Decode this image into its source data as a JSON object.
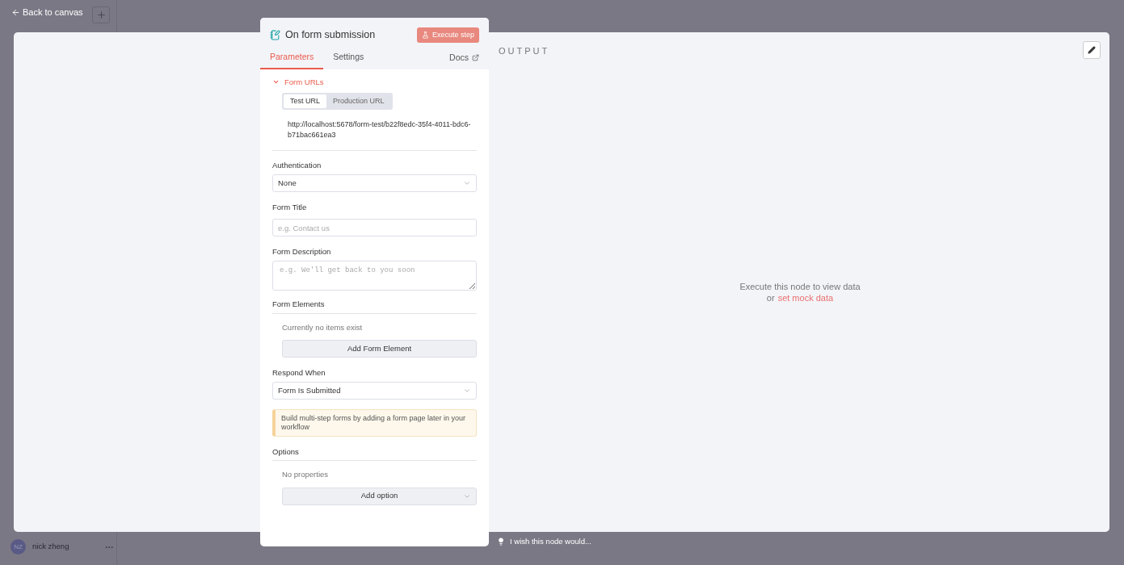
{
  "top_bar": {
    "back_link": "Back to canvas"
  },
  "user": {
    "initials": "NZ",
    "name": "nick zheng"
  },
  "feedback": {
    "text": "I wish this node would..."
  },
  "node_panel": {
    "title": "On form submission",
    "execute_button": {
      "label": "Execute step",
      "disabled": true
    },
    "tabs": [
      {
        "label": "Parameters",
        "selected": true
      },
      {
        "label": "Settings",
        "selected": false
      }
    ],
    "docs_link": "Docs",
    "form_urls": {
      "title": "Form URLs",
      "expanded": true,
      "url_tabs": [
        {
          "label": "Test URL",
          "selected": true
        },
        {
          "label": "Production URL",
          "selected": false
        }
      ],
      "url": "http://localhost:5678/form-test/b22f8edc-35f4-4011-bdc6-b71bac661ea3"
    },
    "parameters": [
      {
        "kind": "select",
        "label": "Authentication",
        "value": "None"
      },
      {
        "kind": "input",
        "label": "Form Title",
        "placeholder": "e.g. Contact us"
      },
      {
        "kind": "textarea",
        "label": "Form Description",
        "placeholder": "e.g. We'll get back to you soon"
      },
      {
        "kind": "collection",
        "label": "Form Elements",
        "empty_text": "Currently no items exist",
        "button": "Add Form Element"
      },
      {
        "kind": "select",
        "label": "Respond When",
        "value": "Form Is Submitted"
      },
      {
        "kind": "notice",
        "text": "Build multi-step forms by adding a form page later in your workflow"
      },
      {
        "kind": "options",
        "label": "Options",
        "empty_text": "No properties",
        "button": "Add option"
      }
    ]
  },
  "output": {
    "title": "OUTPUT",
    "empty_message": "Execute this node to view data",
    "mock_prefix": "or",
    "mock_link": "set mock data"
  }
}
